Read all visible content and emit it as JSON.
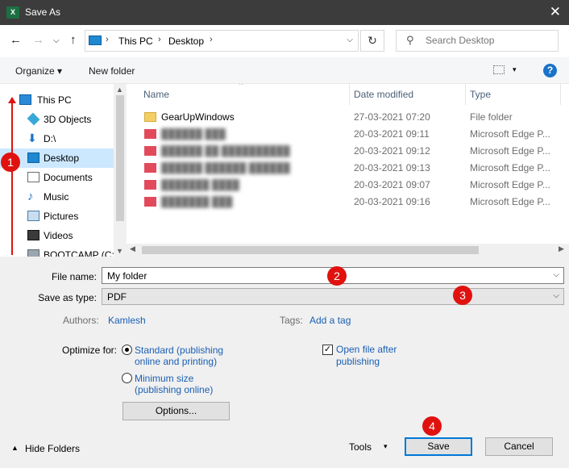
{
  "window": {
    "title": "Save As",
    "app_icon": "excel-icon",
    "close_glyph": "✕"
  },
  "nav": {
    "back_glyph": "←",
    "forward_glyph": "→",
    "recent_glyph": "⌵",
    "up_glyph": "↑",
    "breadcrumb": [
      "This PC",
      "Desktop"
    ],
    "crumb_sep": "›",
    "refresh_glyph": "↻",
    "search_placeholder": "Search Desktop",
    "search_glyph": "⚲"
  },
  "toolbar": {
    "organize": "Organize ▾",
    "new_folder": "New folder",
    "view_caret": "▾",
    "help": "?"
  },
  "sidebar": {
    "items": [
      {
        "label": "This PC",
        "icon": "computer-icon"
      },
      {
        "label": "3D Objects",
        "icon": "3d-objects-icon"
      },
      {
        "label": "D:\\",
        "icon": "download-drive-icon"
      },
      {
        "label": "Desktop",
        "icon": "desktop-icon"
      },
      {
        "label": "Documents",
        "icon": "documents-icon"
      },
      {
        "label": "Music",
        "icon": "music-icon"
      },
      {
        "label": "Pictures",
        "icon": "pictures-icon"
      },
      {
        "label": "Videos",
        "icon": "videos-icon"
      },
      {
        "label": "BOOTCAMP (C:)",
        "icon": "drive-icon"
      }
    ]
  },
  "files": {
    "columns": {
      "name": "Name",
      "date": "Date modified",
      "type": "Type"
    },
    "rows": [
      {
        "name": "GearUpWindows",
        "date": "27-03-2021 07:20",
        "type": "File folder",
        "blurred": false
      },
      {
        "name": "██████ ███",
        "date": "20-03-2021 09:11",
        "type": "Microsoft Edge P...",
        "blurred": true
      },
      {
        "name": "██████ ██ ██████████",
        "date": "20-03-2021 09:12",
        "type": "Microsoft Edge P...",
        "blurred": true
      },
      {
        "name": "██████ ██████ ██████",
        "date": "20-03-2021 09:13",
        "type": "Microsoft Edge P...",
        "blurred": true
      },
      {
        "name": "███████ ████",
        "date": "20-03-2021 09:07",
        "type": "Microsoft Edge P...",
        "blurred": true
      },
      {
        "name": "███████ ███",
        "date": "20-03-2021 09:16",
        "type": "Microsoft Edge P...",
        "blurred": true
      }
    ]
  },
  "form": {
    "file_name_label": "File name:",
    "file_name_value": "My folder",
    "save_type_label": "Save as type:",
    "save_type_value": "PDF",
    "authors_label": "Authors:",
    "authors_value": "Kamlesh",
    "tags_label": "Tags:",
    "tags_value": "Add a tag",
    "optimize_label": "Optimize for:",
    "opt_standard_line1": "Standard (publishing",
    "opt_standard_line2": "online and printing)",
    "opt_minimum_line1": "Minimum size",
    "opt_minimum_line2": "(publishing online)",
    "open_after_line1": "Open file after",
    "open_after_line2": "publishing",
    "open_after_checked": true,
    "options_button": "Options..."
  },
  "footer": {
    "hide_folders": "Hide Folders",
    "tools": "Tools",
    "save": "Save",
    "cancel": "Cancel"
  },
  "annotations": [
    "1",
    "2",
    "3",
    "4"
  ],
  "colors": {
    "annotation_red": "#e0120f",
    "selection": "#cce8ff",
    "link": "#1a5fb4",
    "titlebar": "#3c3c3c"
  }
}
